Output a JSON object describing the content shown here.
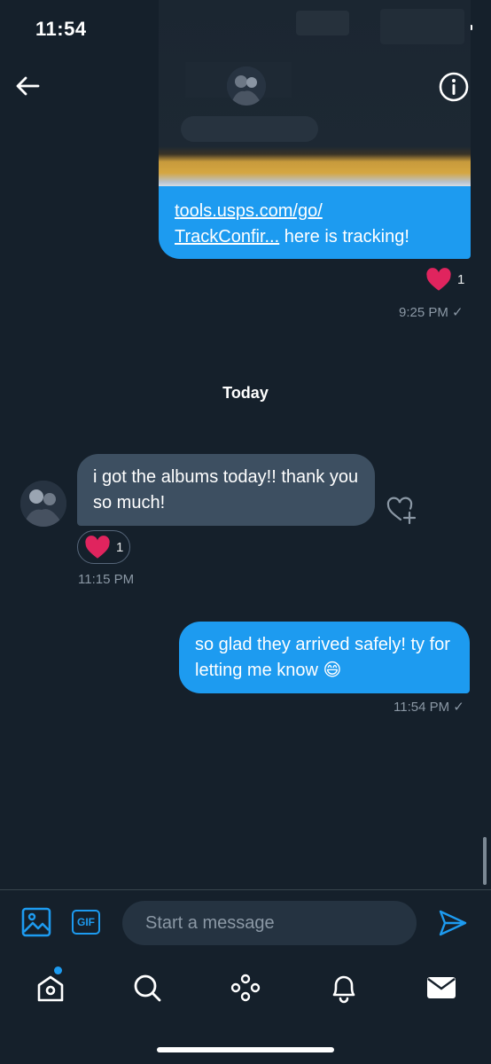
{
  "status_bar": {
    "time": "11:54"
  },
  "header": {
    "back_icon": "arrow-left-icon",
    "info_icon": "info-circle-icon"
  },
  "conversation": {
    "messages": [
      {
        "id": "tracking",
        "direction": "sent",
        "link_text_1": "tools.usps.com/go/",
        "link_text_2": "TrackConfir...",
        "text_after_link": " here is tracking!",
        "reaction_count": "1",
        "time": "9:25 PM ✓"
      },
      {
        "id": "albums",
        "direction": "received",
        "text": "i got the albums today!! thank you so much!",
        "reaction_count": "1",
        "time": "11:15 PM"
      },
      {
        "id": "glad",
        "direction": "sent",
        "text": "so glad they arrived safely! ty for letting me know 😄",
        "time": "11:54 PM ✓"
      }
    ],
    "day_divider": "Today"
  },
  "composer": {
    "placeholder": "Start a message",
    "gif_label": "GIF"
  },
  "tab_bar": {
    "items": [
      "home-icon",
      "search-icon",
      "spaces-icon",
      "notifications-icon",
      "messages-icon"
    ],
    "has_home_notification_dot": true
  },
  "colors": {
    "background": "#15202b",
    "sent_bubble": "#1d9bf0",
    "received_bubble": "#3d4f61",
    "like": "#f91880",
    "muted_text": "#8b98a5"
  }
}
